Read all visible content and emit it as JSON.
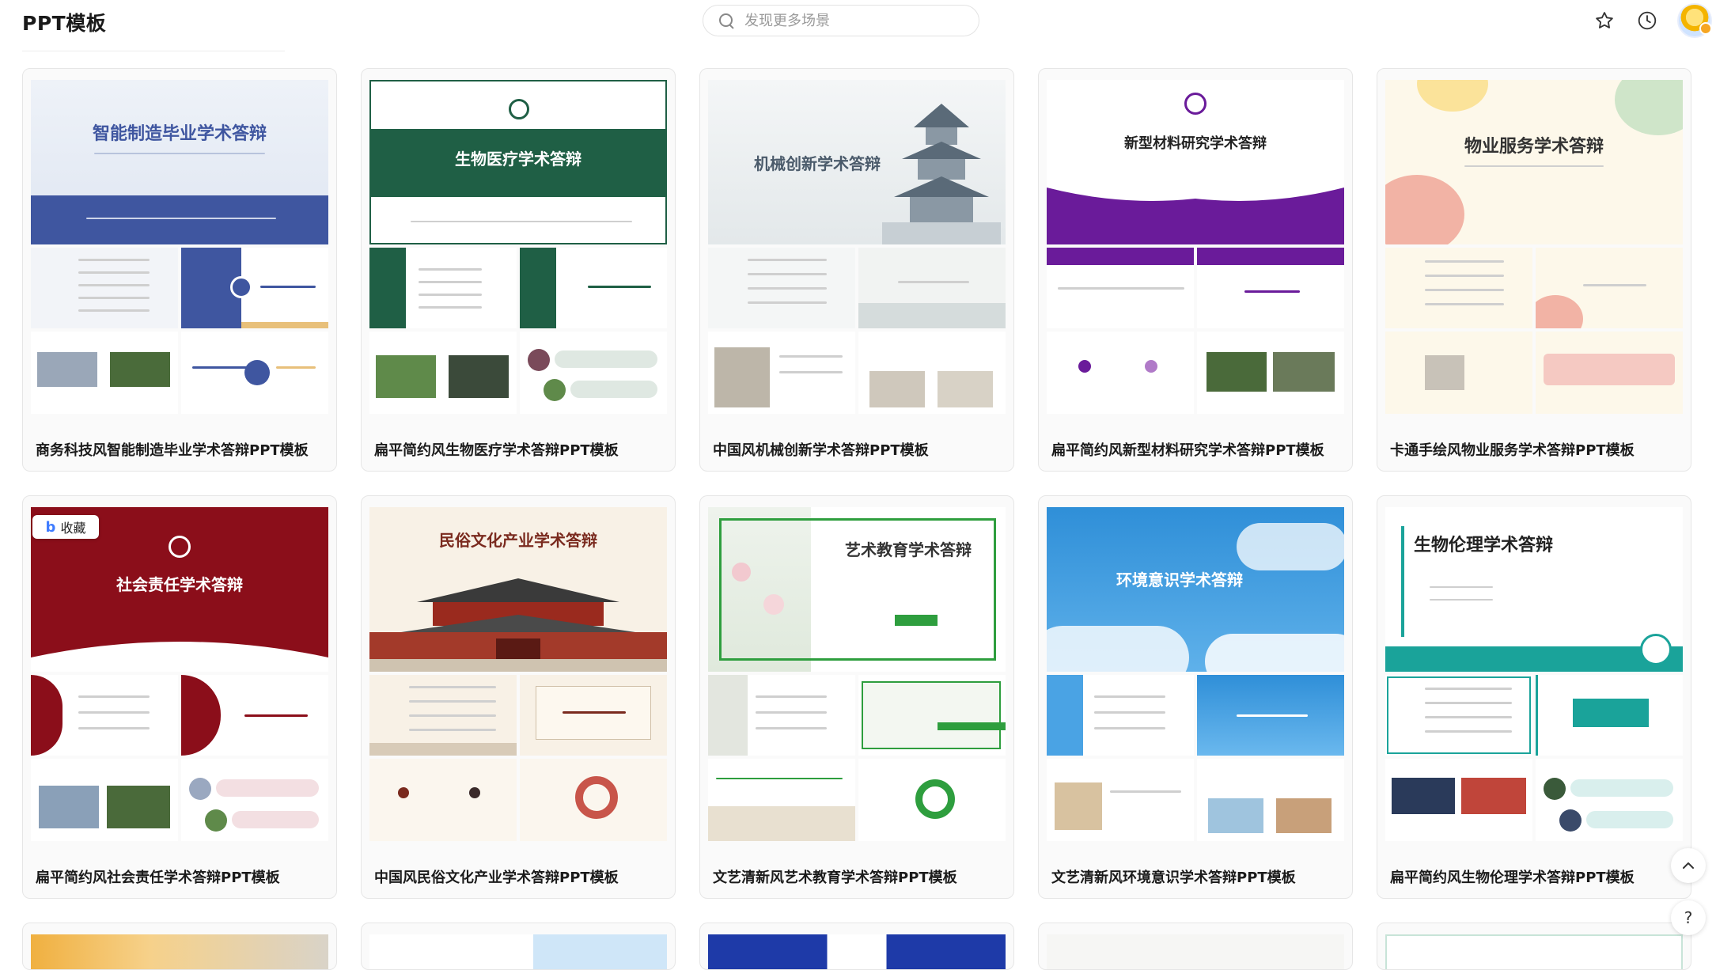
{
  "header": {
    "title": "PPT模板",
    "search_placeholder": "发现更多场景"
  },
  "icons": {
    "favorites": "star-icon",
    "history": "clock-icon",
    "avatar": "user-avatar"
  },
  "collect_label": "收藏",
  "cards": [
    {
      "label": "商务科技风智能制造毕业学术答辩PPT模板",
      "slide_title": "智能制造毕业学术答辩",
      "accent": "#3f56a0"
    },
    {
      "label": "扁平简约风生物医疗学术答辩PPT模板",
      "slide_title": "生物医疗学术答辩",
      "accent": "#1f5f45"
    },
    {
      "label": "中国风机械创新学术答辩PPT模板",
      "slide_title": "机械创新学术答辩",
      "accent": "#6b7c8c"
    },
    {
      "label": "扁平简约风新型材料研究学术答辩PPT模板",
      "slide_title": "新型材料研究学术答辩",
      "accent": "#6a1b9a"
    },
    {
      "label": "卡通手绘风物业服务学术答辩PPT模板",
      "slide_title": "物业服务学术答辩",
      "accent": "#e8a0a0"
    },
    {
      "label": "扁平简约风社会责任学术答辩PPT模板",
      "slide_title": "社会责任学术答辩",
      "accent": "#8b0e1a"
    },
    {
      "label": "中国风民俗文化产业学术答辩PPT模板",
      "slide_title": "民俗文化产业学术答辩",
      "accent": "#8a2a1e"
    },
    {
      "label": "文艺清新风艺术教育学术答辩PPT模板",
      "slide_title": "艺术教育学术答辩",
      "accent": "#2e9e3e"
    },
    {
      "label": "文艺清新风环境意识学术答辩PPT模板",
      "slide_title": "环境意识学术答辩",
      "accent": "#2f8fd8"
    },
    {
      "label": "扁平简约风生物伦理学术答辩PPT模板",
      "slide_title": "生物伦理学术答辩",
      "accent": "#1aa39a"
    }
  ],
  "side_buttons": {
    "top": "back-to-top",
    "help": "?"
  }
}
